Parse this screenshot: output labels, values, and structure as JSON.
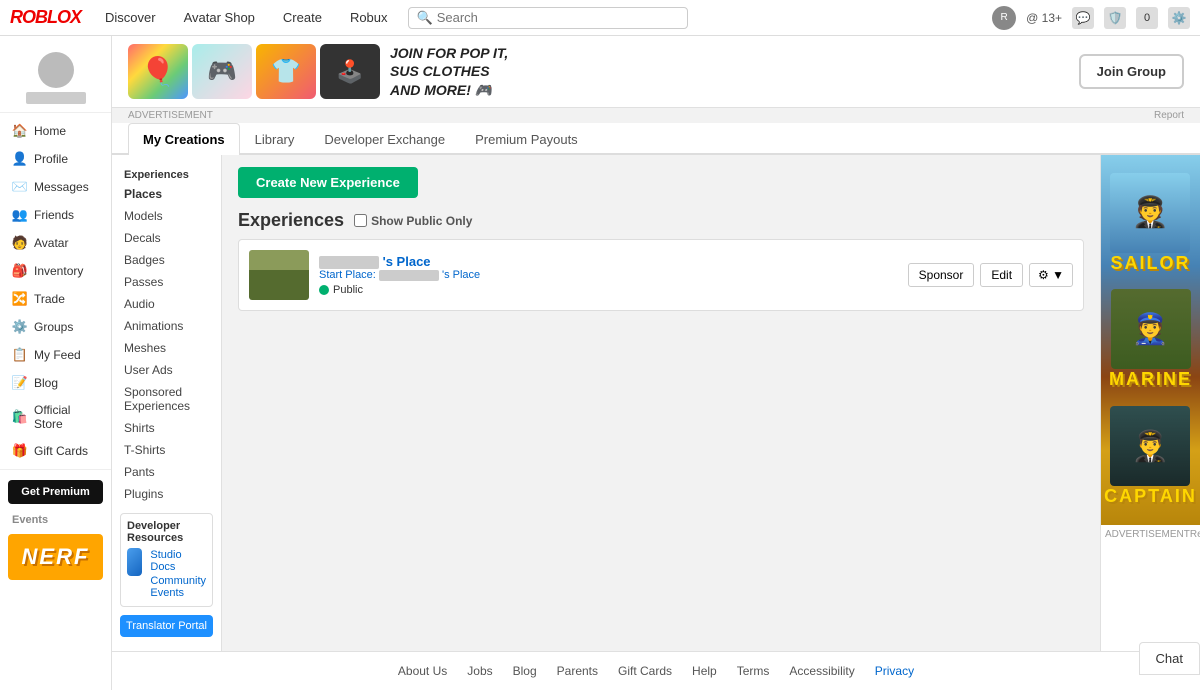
{
  "topnav": {
    "logo": "ROBLOX",
    "links": [
      "Discover",
      "Avatar Shop",
      "Create",
      "Robux"
    ],
    "search_placeholder": "Search",
    "username": "@            13+",
    "icons": [
      "chat-icon",
      "shield-icon",
      "notification-icon",
      "settings-icon"
    ]
  },
  "sidebar": {
    "username": "username",
    "items": [
      {
        "label": "Home",
        "icon": "🏠"
      },
      {
        "label": "Profile",
        "icon": "👤"
      },
      {
        "label": "Messages",
        "icon": "✉️"
      },
      {
        "label": "Friends",
        "icon": "👥"
      },
      {
        "label": "Avatar",
        "icon": "🧑"
      },
      {
        "label": "Inventory",
        "icon": "🎒"
      },
      {
        "label": "Trade",
        "icon": "🔀"
      },
      {
        "label": "Groups",
        "icon": "⚙️"
      },
      {
        "label": "My Feed",
        "icon": "📋"
      },
      {
        "label": "Blog",
        "icon": "📝"
      },
      {
        "label": "Official Store",
        "icon": "🛍️"
      },
      {
        "label": "Gift Cards",
        "icon": "🎁"
      }
    ],
    "get_premium": "Get Premium",
    "events_label": "Events",
    "nerf_label": "NERF"
  },
  "ad_banner": {
    "title": "JOIN FOR POP IT,\nSUS CLOTHES\nAND MORE! 🎮",
    "join_btn": "Join Group",
    "advertisement_label": "ADVERTISEMENT",
    "report_label": "Report"
  },
  "tabs": [
    {
      "label": "My Creations",
      "active": true
    },
    {
      "label": "Library",
      "active": false
    },
    {
      "label": "Developer Exchange",
      "active": false
    },
    {
      "label": "Premium Payouts",
      "active": false
    }
  ],
  "left_nav": {
    "section": "Experiences",
    "items": [
      "Places",
      "Models",
      "Decals",
      "Badges",
      "Passes",
      "Audio",
      "Animations",
      "Meshes",
      "User Ads",
      "Sponsored Experiences",
      "Shirts",
      "T-Shirts",
      "Pants",
      "Plugins"
    ],
    "dev_resources": {
      "title": "Developer Resources",
      "links": [
        "Studio Docs",
        "Community Events"
      ]
    },
    "translator_btn": "Translator Portal"
  },
  "main_panel": {
    "create_btn": "Create New Experience",
    "section_title": "Experiences",
    "show_public_label": "Show Public Only",
    "experience": {
      "name": "'s Place",
      "start_place": "Start Place:",
      "start_place_name": "'s Place",
      "status": "Public",
      "btn_sponsor": "Sponsor",
      "btn_edit": "Edit",
      "btn_settings": "⚙ ▼"
    }
  },
  "right_ad": {
    "advertisement_label": "ADVERTISEMENT",
    "report_label": "Report",
    "ranks": [
      "SAILOR",
      "MARINE",
      "CAPTAIN"
    ]
  },
  "footer": {
    "links": [
      "About Us",
      "Jobs",
      "Blog",
      "Parents",
      "Gift Cards",
      "Help",
      "Terms",
      "Accessibility",
      "Privacy"
    ],
    "active_link": "Privacy"
  },
  "chat": {
    "label": "Chat"
  }
}
